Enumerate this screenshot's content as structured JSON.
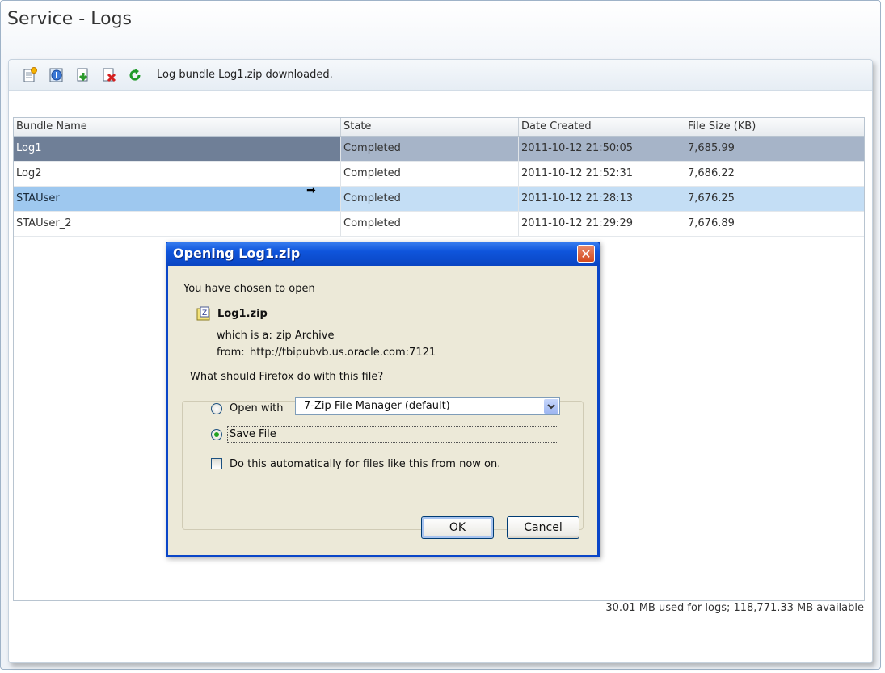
{
  "page": {
    "title": "Service - Logs"
  },
  "toolbar": {
    "icons": [
      "new-log-icon",
      "info-icon",
      "download-icon",
      "delete-icon",
      "refresh-icon"
    ],
    "status_message": "Log bundle Log1.zip downloaded."
  },
  "table": {
    "headers": [
      "Bundle Name",
      "State",
      "Date Created",
      "File Size (KB)"
    ],
    "rows": [
      {
        "name": "Log1",
        "state": "Completed",
        "date": "2011-10-12 21:50:05",
        "size": "7,685.99"
      },
      {
        "name": "Log2",
        "state": "Completed",
        "date": "2011-10-12 21:52:31",
        "size": "7,686.22"
      },
      {
        "name": "STAUser",
        "state": "Completed",
        "date": "2011-10-12 21:28:13",
        "size": "7,676.25"
      },
      {
        "name": "STAUser_2",
        "state": "Completed",
        "date": "2011-10-12 21:29:29",
        "size": "7,676.89"
      }
    ]
  },
  "footer": {
    "storage": "30.01 MB used for logs; 118,771.33 MB available"
  },
  "dialog": {
    "title": "Opening Log1.zip",
    "intro": "You have chosen to open",
    "file_name": "Log1.zip",
    "which_is_label": "which is a:",
    "which_is_value": "zip Archive",
    "from_label": "from:",
    "from_value": "http://tbipubvb.us.oracle.com:7121",
    "group_label": "What should Firefox do with this file?",
    "open_with_label": "Open with",
    "open_with_value": "7-Zip File Manager (default)",
    "save_file_label": "Save File",
    "auto_label": "Do this automatically for files like this from now on.",
    "ok_label": "OK",
    "cancel_label": "Cancel"
  },
  "colors": {
    "dialog_titlebar": "#0a45c2",
    "selected_row": "#6f7f97",
    "hover_row": "#9ec8ef"
  }
}
